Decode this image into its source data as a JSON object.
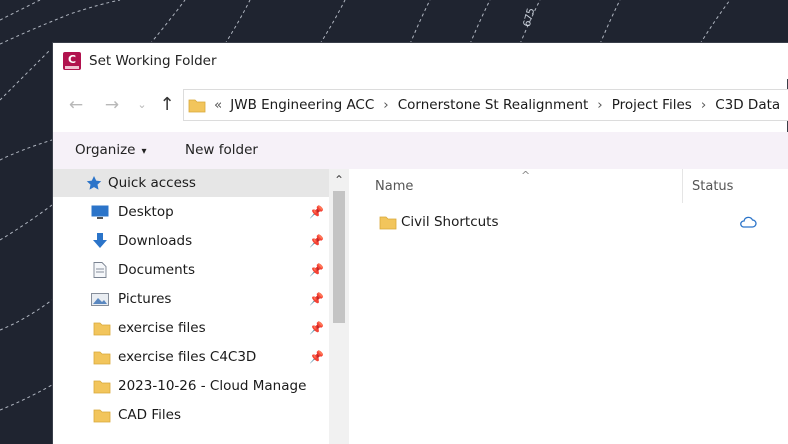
{
  "background": {
    "contour_label": "675"
  },
  "window": {
    "title": "Set Working Folder",
    "app_icon_letter": "C"
  },
  "navigation": {
    "back_glyph": "←",
    "forward_glyph": "→",
    "recent_glyph": "⌄",
    "up_glyph": "↑"
  },
  "address_bar": {
    "overflow_glyph": "«",
    "separator": "›",
    "breadcrumbs": [
      "JWB Engineering ACC",
      "Cornerstone St Realignment",
      "Project Files",
      "C3D Data"
    ]
  },
  "toolbar": {
    "organize_label": "Organize",
    "organize_caret": "▾",
    "new_folder_label": "New folder"
  },
  "nav_pane": {
    "scroll_up_glyph": "⌃",
    "items": [
      {
        "label": "Quick access",
        "icon": "star-icon",
        "pinned": false
      },
      {
        "label": "Desktop",
        "icon": "desktop-icon",
        "pinned": true
      },
      {
        "label": "Downloads",
        "icon": "download-arrow-icon",
        "pinned": true
      },
      {
        "label": "Documents",
        "icon": "document-icon",
        "pinned": true
      },
      {
        "label": "Pictures",
        "icon": "pictures-icon",
        "pinned": true
      },
      {
        "label": "exercise files",
        "icon": "folder-icon",
        "pinned": true
      },
      {
        "label": "exercise files C4C3D",
        "icon": "folder-icon",
        "pinned": true
      },
      {
        "label": "2023-10-26 - Cloud Manage",
        "icon": "folder-icon",
        "pinned": false
      },
      {
        "label": "CAD Files",
        "icon": "folder-icon",
        "pinned": false
      }
    ]
  },
  "file_list": {
    "columns": [
      "Name",
      "Status"
    ],
    "sort_indicator": "^",
    "rows": [
      {
        "name": "Civil Shortcuts",
        "icon": "folder-icon",
        "status_icon": "cloud-icon"
      }
    ]
  },
  "colors": {
    "background": "#1f2430",
    "folder": "#f2c55c",
    "accent_blue": "#2b74c9",
    "app_icon": "#b1124e"
  }
}
